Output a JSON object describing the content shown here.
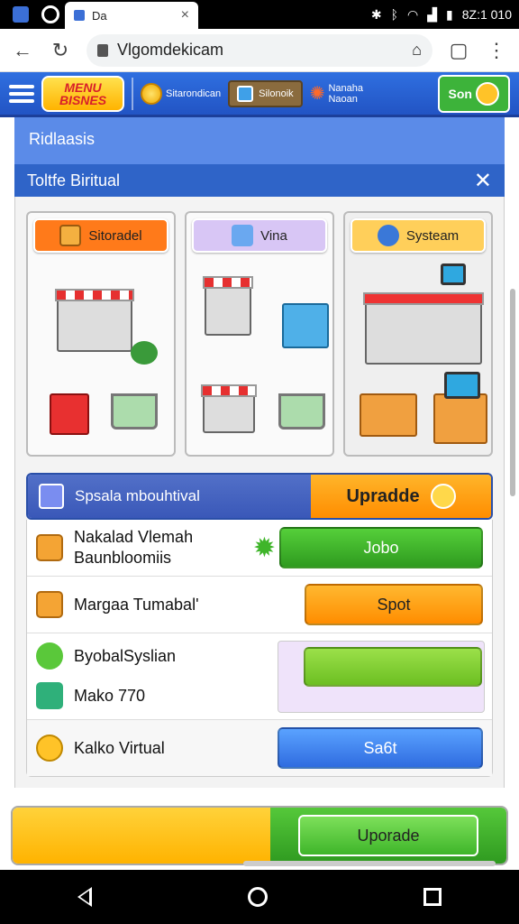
{
  "status": {
    "tab_title": "Da",
    "time": "8Z:1 010"
  },
  "browser": {
    "url": "Vlgomdekicam"
  },
  "header": {
    "logo_line1": "MENU",
    "logo_line2": "BISNES",
    "nav1": "Sitarondican",
    "nav2": "Silonoik",
    "nav3_line1": "Nanaha",
    "nav3_line2": "Naoan",
    "cta": "Son"
  },
  "breadcrumb": "Ridlaasis",
  "panel_title": "Toltfe Biritual",
  "cards": [
    {
      "label": "Sitoradel",
      "color": "#ff7a1a"
    },
    {
      "label": "Vina",
      "color": "#d8c6f5"
    },
    {
      "label": "Systeam",
      "color": "#ffcf5a"
    }
  ],
  "upgrade": {
    "title": "Spsala mbouhtival",
    "button": "Upradde"
  },
  "rows": [
    {
      "label1": "Nakalad Vlemah",
      "label2": "Baunbloomiis",
      "button": "Jobo"
    },
    {
      "label1": "Margaa Tumabal'",
      "button": "Spot"
    },
    {
      "label1": "ByobalSyslian",
      "label2": "Mako 770"
    },
    {
      "label1": "Kalko Virtual",
      "button": "Sa6t"
    }
  ],
  "bottom": {
    "button": "Uporade"
  }
}
